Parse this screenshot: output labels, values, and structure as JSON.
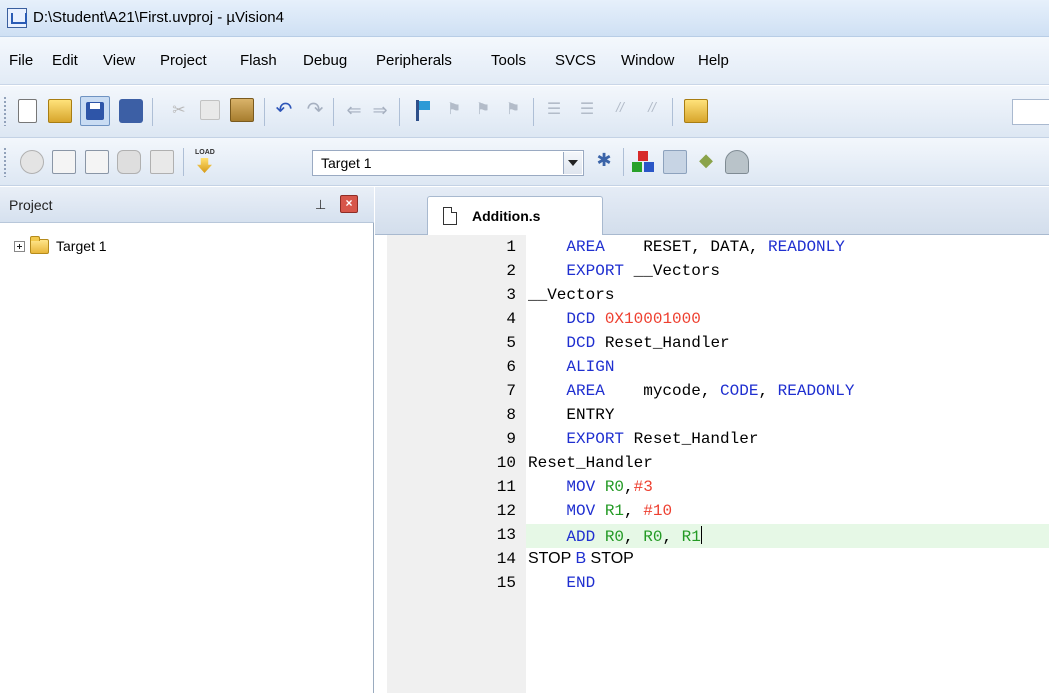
{
  "window": {
    "title": "D:\\Student\\A21\\First.uvproj - µVision4"
  },
  "menu": [
    "File",
    "Edit",
    "View",
    "Project",
    "Flash",
    "Debug",
    "Peripherals",
    "Tools",
    "SVCS",
    "Window",
    "Help"
  ],
  "toolbar1": {
    "icons": [
      "new-file-icon",
      "open-folder-icon",
      "save-icon",
      "save-all-icon",
      "cut-icon",
      "copy-icon",
      "paste-icon",
      "undo-icon",
      "redo-icon",
      "navigate-back-icon",
      "navigate-forward-icon",
      "insert-bookmark-icon",
      "previous-bookmark-icon",
      "next-bookmark-icon",
      "clear-bookmarks-icon",
      "indent-icon",
      "unindent-icon",
      "comment-icon",
      "uncomment-icon",
      "find-in-files-icon"
    ]
  },
  "toolbar2": {
    "icons": [
      "translate-icon",
      "build-icon",
      "rebuild-icon",
      "batch-build-icon",
      "stop-build-icon",
      "download-icon",
      "target-options-icon",
      "components-icon",
      "manage-books-icon",
      "select-packs-icon",
      "environment-icon"
    ],
    "target_select": "Target 1"
  },
  "project_pane": {
    "title": "Project",
    "pin_glyph": "⊥",
    "close_glyph": "×",
    "tree": [
      {
        "label": "Target 1",
        "icon": "folder-icon"
      }
    ]
  },
  "editor": {
    "tab_label": "Addition.s",
    "current_line": 13,
    "lines": [
      {
        "num": "1",
        "tokens": [
          {
            "t": "    "
          },
          {
            "t": "AREA",
            "c": "kw"
          },
          {
            "t": "    RESET, DATA, "
          },
          {
            "t": "READONLY",
            "c": "kw"
          }
        ]
      },
      {
        "num": "2",
        "tokens": [
          {
            "t": "    "
          },
          {
            "t": "EXPORT",
            "c": "kw"
          },
          {
            "t": " __Vectors"
          }
        ]
      },
      {
        "num": "3",
        "tokens": [
          {
            "t": "__Vectors"
          }
        ]
      },
      {
        "num": "4",
        "tokens": [
          {
            "t": "    "
          },
          {
            "t": "DCD",
            "c": "kw"
          },
          {
            "t": " "
          },
          {
            "t": "0X10001000",
            "c": "num"
          }
        ]
      },
      {
        "num": "5",
        "tokens": [
          {
            "t": "    "
          },
          {
            "t": "DCD",
            "c": "kw"
          },
          {
            "t": " Reset_Handler"
          }
        ]
      },
      {
        "num": "6",
        "tokens": [
          {
            "t": "    "
          },
          {
            "t": "ALIGN",
            "c": "kw"
          }
        ]
      },
      {
        "num": "7",
        "tokens": [
          {
            "t": "    "
          },
          {
            "t": "AREA",
            "c": "kw"
          },
          {
            "t": "    mycode, "
          },
          {
            "t": "CODE",
            "c": "kw"
          },
          {
            "t": ", "
          },
          {
            "t": "READONLY",
            "c": "kw"
          }
        ]
      },
      {
        "num": "8",
        "tokens": [
          {
            "t": "    ENTRY"
          }
        ]
      },
      {
        "num": "9",
        "tokens": [
          {
            "t": "    "
          },
          {
            "t": "EXPORT",
            "c": "kw"
          },
          {
            "t": " Reset_Handler"
          }
        ]
      },
      {
        "num": "10",
        "tokens": [
          {
            "t": "Reset_Handler"
          }
        ]
      },
      {
        "num": "11",
        "tokens": [
          {
            "t": "    "
          },
          {
            "t": "MOV",
            "c": "kw"
          },
          {
            "t": " "
          },
          {
            "t": "R0",
            "c": "reg"
          },
          {
            "t": ","
          },
          {
            "t": "#3",
            "c": "num"
          }
        ]
      },
      {
        "num": "12",
        "tokens": [
          {
            "t": "    "
          },
          {
            "t": "MOV",
            "c": "kw"
          },
          {
            "t": " "
          },
          {
            "t": "R1",
            "c": "reg"
          },
          {
            "t": ", "
          },
          {
            "t": "#10",
            "c": "num"
          }
        ]
      },
      {
        "num": "13",
        "tokens": [
          {
            "t": "    "
          },
          {
            "t": "ADD",
            "c": "kw"
          },
          {
            "t": " "
          },
          {
            "t": "R0",
            "c": "reg"
          },
          {
            "t": ", "
          },
          {
            "t": "R0",
            "c": "reg"
          },
          {
            "t": ", "
          },
          {
            "t": "R1",
            "c": "reg"
          }
        ],
        "caret": true
      },
      {
        "num": "14",
        "prop": true,
        "tokens": [
          {
            "t": "STOP "
          },
          {
            "t": "B",
            "c": "kw"
          },
          {
            "t": " STOP"
          }
        ]
      },
      {
        "num": "15",
        "tokens": [
          {
            "t": "    "
          },
          {
            "t": "END",
            "c": "kw"
          }
        ]
      }
    ]
  }
}
